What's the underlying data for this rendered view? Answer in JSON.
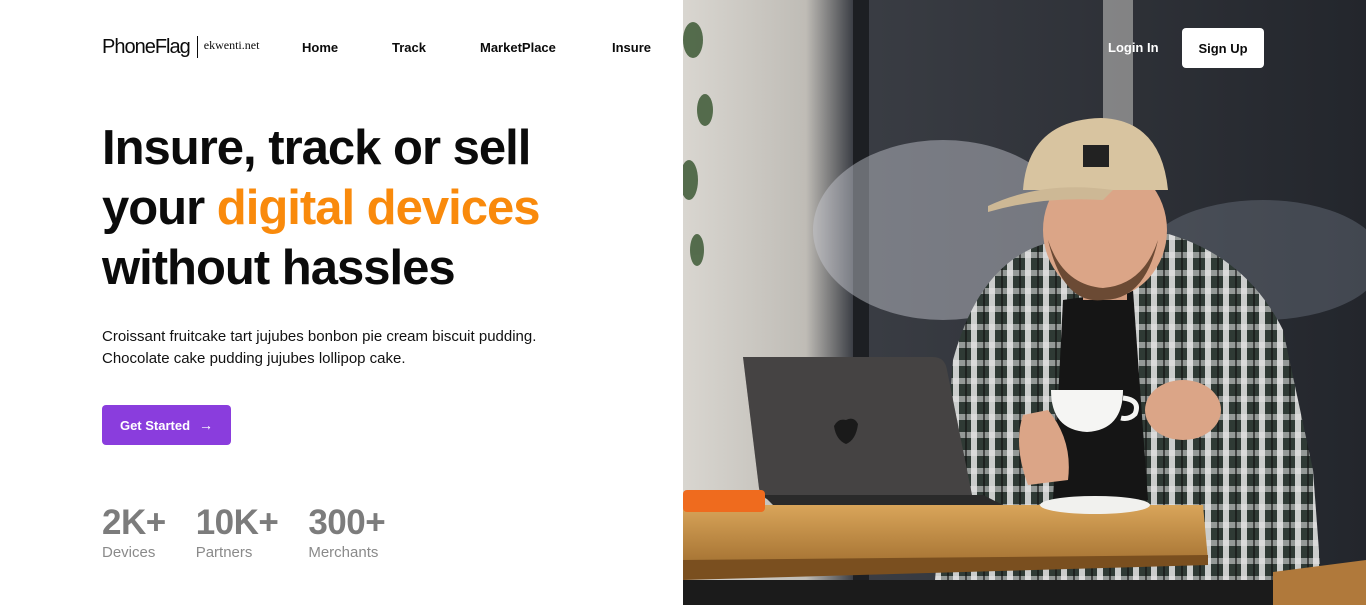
{
  "logo": {
    "brand": "PhoneFlag",
    "sub": "ekwenti.net"
  },
  "nav": [
    {
      "label": "Home"
    },
    {
      "label": "Track"
    },
    {
      "label": "MarketPlace"
    },
    {
      "label": "Insure"
    }
  ],
  "auth": {
    "login": "Login In",
    "signup": "Sign Up"
  },
  "hero": {
    "line1": "Insure, track or sell",
    "line2_prefix": "your ",
    "line2_accent": "digital devices",
    "line3": "without hassles",
    "copy_line1": "Croissant fruitcake tart jujubes bonbon pie cream biscuit pudding.",
    "copy_line2": "Chocolate cake pudding jujubes lollipop cake.",
    "cta": "Get Started",
    "cta_icon": "arrow-right-icon"
  },
  "stats": [
    {
      "value": "2K+",
      "label": "Devices"
    },
    {
      "value": "10K+",
      "label": "Partners"
    },
    {
      "value": "300+",
      "label": "Merchants"
    }
  ],
  "colors": {
    "accent": "#f98a0c",
    "primary": "#8a3ddd",
    "stat": "#7c7c7c"
  }
}
